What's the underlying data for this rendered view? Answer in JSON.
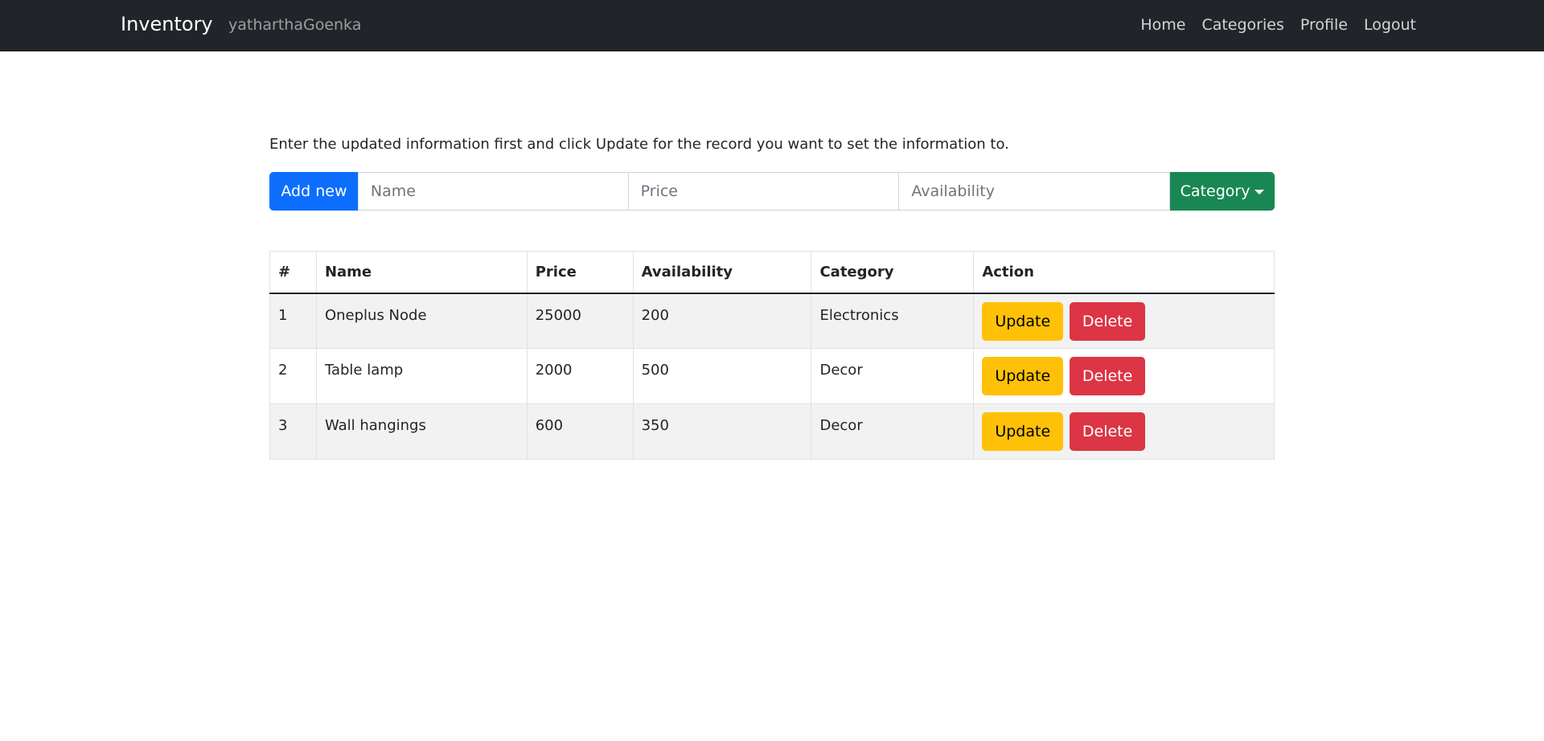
{
  "navbar": {
    "brand": "Inventory",
    "username": "yatharthaGoenka",
    "links": [
      "Home",
      "Categories",
      "Profile",
      "Logout"
    ]
  },
  "instruction": "Enter the updated information first and click Update for the record you want to set the information to.",
  "form": {
    "add_label": "Add new",
    "name_placeholder": "Name",
    "price_placeholder": "Price",
    "availability_placeholder": "Availability",
    "category_label": "Category"
  },
  "table": {
    "headers": [
      "#",
      "Name",
      "Price",
      "Availability",
      "Category",
      "Action"
    ],
    "update_label": "Update",
    "delete_label": "Delete",
    "rows": [
      {
        "id": "1",
        "name": "Oneplus Node",
        "price": "25000",
        "availability": "200",
        "category": "Electronics"
      },
      {
        "id": "2",
        "name": "Table lamp",
        "price": "2000",
        "availability": "500",
        "category": "Decor"
      },
      {
        "id": "3",
        "name": "Wall hangings",
        "price": "600",
        "availability": "350",
        "category": "Decor"
      }
    ]
  },
  "colors": {
    "navbar_bg": "#212529",
    "primary": "#0d6efd",
    "success": "#198754",
    "warning": "#ffc107",
    "danger": "#dc3545"
  }
}
